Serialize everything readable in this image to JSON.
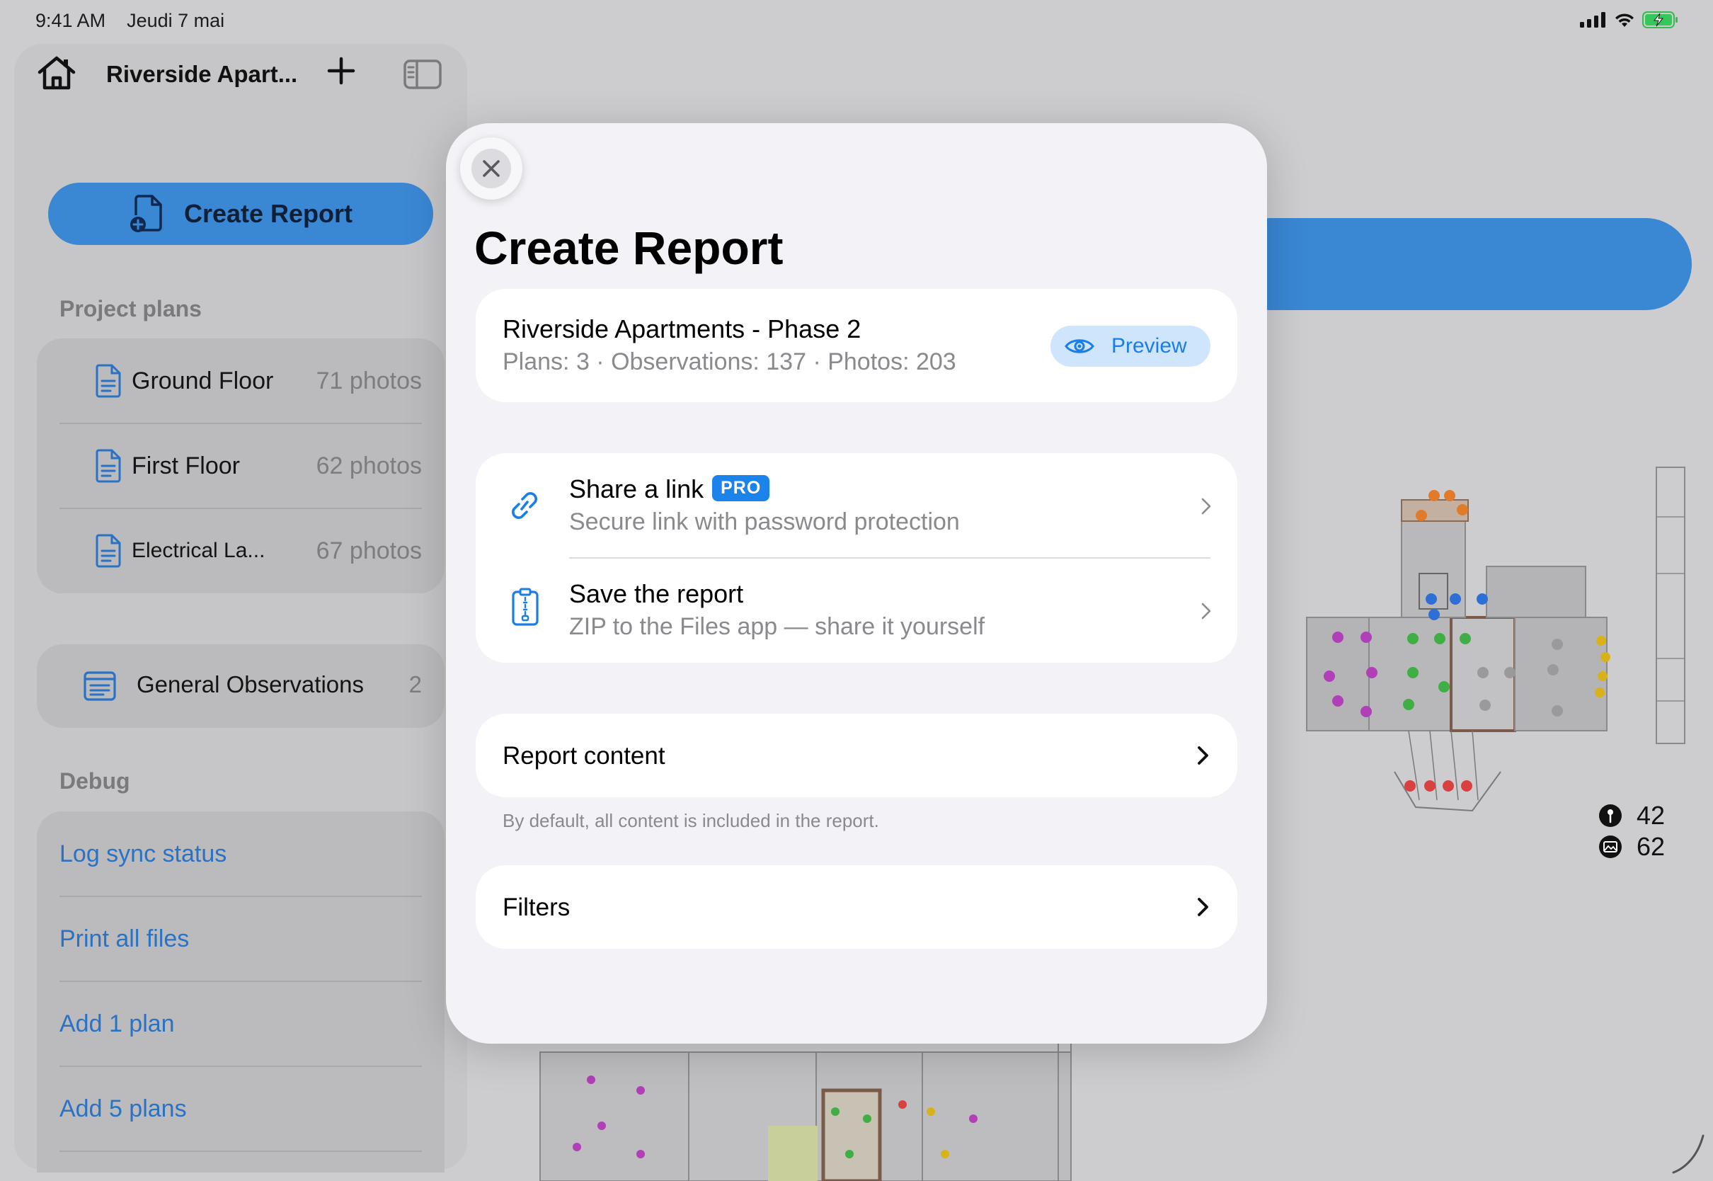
{
  "status_bar": {
    "time": "9:41 AM",
    "date": "Jeudi 7 mai",
    "icons": [
      "cellular-signal-icon",
      "wifi-icon",
      "battery-charging-icon"
    ]
  },
  "sidebar": {
    "title": "Riverside Apart...",
    "create_report_label": "Create Report",
    "plans_header": "Project plans",
    "plans": [
      {
        "name": "Ground Floor",
        "count": "71 photos"
      },
      {
        "name": "First Floor",
        "count": "62 photos"
      },
      {
        "name": "Electrical La...",
        "count": "67 photos"
      }
    ],
    "general_observations": {
      "label": "General Observations",
      "count": "2"
    },
    "debug_header": "Debug",
    "debug_items": [
      "Log sync status",
      "Print all files",
      "Add 1 plan",
      "Add 5 plans"
    ]
  },
  "background": {
    "stats": {
      "pins": "42",
      "photos": "62"
    }
  },
  "modal": {
    "title": "Create Report",
    "project": {
      "name": "Riverside Apartments - Phase 2",
      "meta": "Plans: 3 · Observations: 137 · Photos: 203",
      "preview_label": "Preview"
    },
    "options": [
      {
        "title": "Share a link",
        "badge": "PRO",
        "subtitle": "Secure link with password protection"
      },
      {
        "title": "Save the report",
        "subtitle": "ZIP to the Files app — share it yourself"
      }
    ],
    "report_content_label": "Report content",
    "report_content_note": "By default, all content is included in the report.",
    "filters_label": "Filters"
  },
  "colors": {
    "accent": "#1b83ea",
    "sidebar_button": "#3a87d4",
    "modal_bg": "#f2f2f7"
  }
}
